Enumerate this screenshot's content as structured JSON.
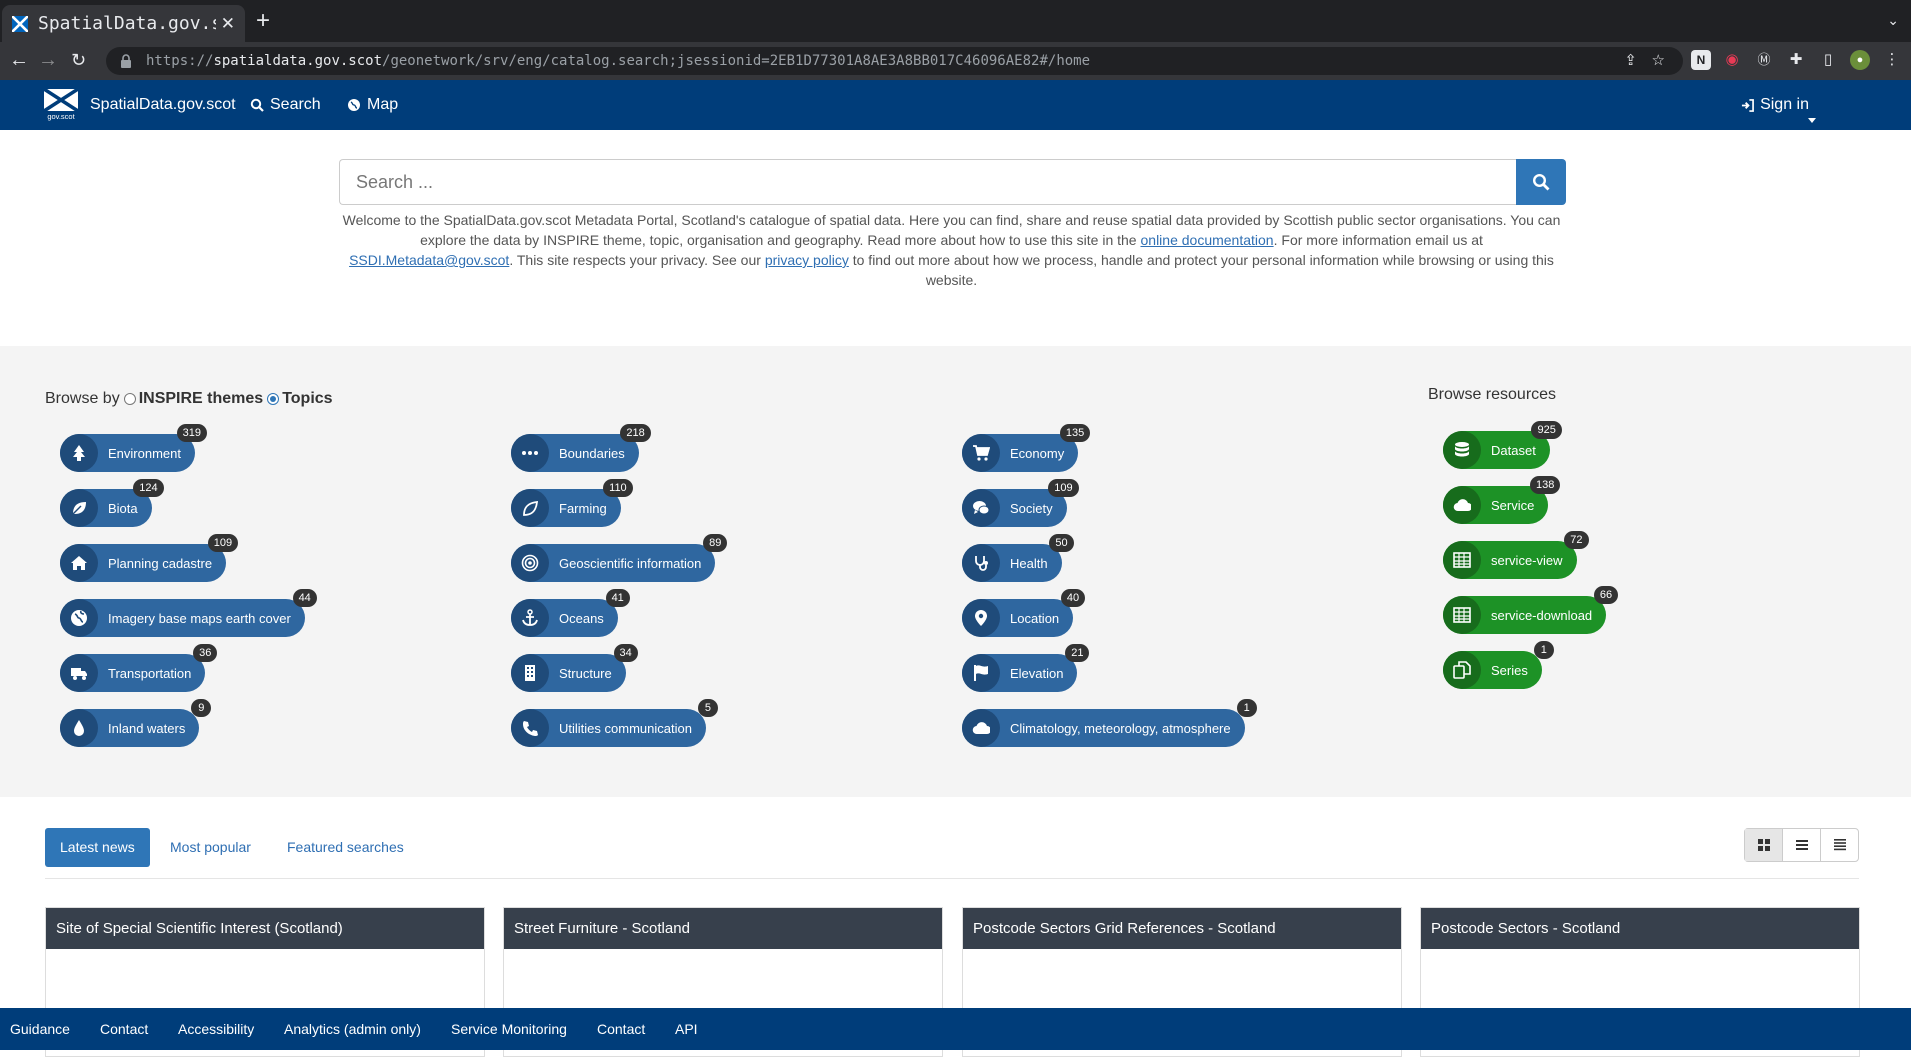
{
  "browser": {
    "tab_title": "SpatialData.gov.scot",
    "url_scheme": "https://",
    "url_host": "spatialdata.gov.scot",
    "url_path": "/geonetwork/srv/eng/catalog.search;jsessionid=2EB1D77301A8AE3A8BB017C46096AE82#/home"
  },
  "header": {
    "logo_text": "gov.scot",
    "brand": "SpatialData.gov.scot",
    "nav": {
      "search": "Search",
      "map": "Map"
    },
    "sign_in": "Sign in"
  },
  "search": {
    "placeholder": "Search ...",
    "welcome_1": "Welcome to the SpatialData.gov.scot Metadata Portal, Scotland's catalogue of spatial data. Here you can find, share and reuse spatial data provided by Scottish public sector organisations. You can explore the data by INSPIRE theme, topic, organisation and geography. Read more about how to use this site in the ",
    "link_docs": "online documentation",
    "welcome_2": ". For more information email us at ",
    "link_email": "SSDI.Metadata@gov.scot",
    "welcome_3": ". This site respects your privacy. See our ",
    "link_privacy": "privacy policy",
    "welcome_4": " to find out more about how we process, handle and protect your personal information while browsing or using this website."
  },
  "browse": {
    "browse_by": "Browse by",
    "option_inspire": "INSPIRE themes",
    "option_topics": "Topics",
    "resources_title": "Browse resources",
    "topics": [
      {
        "label": "Environment",
        "count": "319",
        "icon": "tree-icon"
      },
      {
        "label": "Biota",
        "count": "124",
        "icon": "leaf-icon"
      },
      {
        "label": "Planning cadastre",
        "count": "109",
        "icon": "home-icon"
      },
      {
        "label": "Imagery base maps earth cover",
        "count": "44",
        "icon": "globe-icon"
      },
      {
        "label": "Transportation",
        "count": "36",
        "icon": "truck-icon"
      },
      {
        "label": "Inland waters",
        "count": "9",
        "icon": "tint-icon"
      },
      {
        "label": "Boundaries",
        "count": "218",
        "icon": "ellipsis-icon"
      },
      {
        "label": "Farming",
        "count": "110",
        "icon": "seedling-icon"
      },
      {
        "label": "Geoscientific information",
        "count": "89",
        "icon": "bullseye-icon"
      },
      {
        "label": "Oceans",
        "count": "41",
        "icon": "anchor-icon"
      },
      {
        "label": "Structure",
        "count": "34",
        "icon": "building-icon"
      },
      {
        "label": "Utilities communication",
        "count": "5",
        "icon": "phone-icon"
      },
      {
        "label": "Economy",
        "count": "135",
        "icon": "cart-icon"
      },
      {
        "label": "Society",
        "count": "109",
        "icon": "comments-icon"
      },
      {
        "label": "Health",
        "count": "50",
        "icon": "stethoscope-icon"
      },
      {
        "label": "Location",
        "count": "40",
        "icon": "map-marker-icon"
      },
      {
        "label": "Elevation",
        "count": "21",
        "icon": "flag-icon"
      },
      {
        "label": "Climatology, meteorology, atmosphere",
        "count": "1",
        "icon": "cloud-icon"
      }
    ],
    "resources": [
      {
        "label": "Dataset",
        "count": "925",
        "icon": "database-icon"
      },
      {
        "label": "Service",
        "count": "138",
        "icon": "cloud-icon"
      },
      {
        "label": "service-view",
        "count": "72",
        "icon": "table-icon"
      },
      {
        "label": "service-download",
        "count": "66",
        "icon": "table-icon"
      },
      {
        "label": "Series",
        "count": "1",
        "icon": "copy-icon"
      }
    ]
  },
  "home_tabs": {
    "latest": "Latest news",
    "popular": "Most popular",
    "featured": "Featured searches"
  },
  "cards": [
    "Site of Special Scientific Interest (Scotland)",
    "Street Furniture - Scotland",
    "Postcode Sectors Grid References - Scotland",
    "Postcode Sectors - Scotland"
  ],
  "footer": [
    "Guidance",
    "Contact",
    "Accessibility",
    "Analytics (admin only)",
    "Service Monitoring",
    "Contact",
    "API"
  ]
}
